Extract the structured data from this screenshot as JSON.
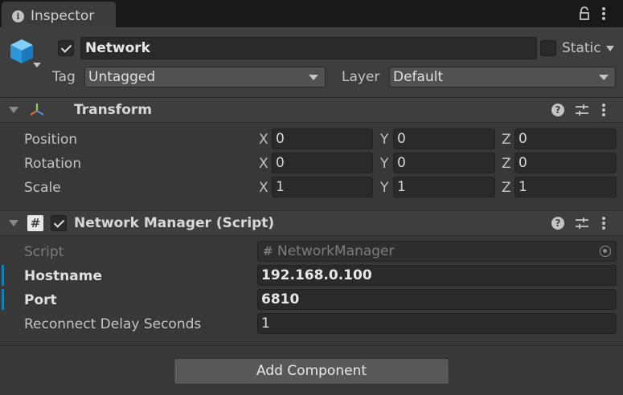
{
  "tab": {
    "title": "Inspector"
  },
  "object": {
    "name": "Network",
    "active": true,
    "static_label": "Static",
    "tag_label": "Tag",
    "tag_value": "Untagged",
    "layer_label": "Layer",
    "layer_value": "Default"
  },
  "transform": {
    "title": "Transform",
    "rows": [
      {
        "label": "Position",
        "x": "0",
        "y": "0",
        "z": "0"
      },
      {
        "label": "Rotation",
        "x": "0",
        "y": "0",
        "z": "0"
      },
      {
        "label": "Scale",
        "x": "1",
        "y": "1",
        "z": "1"
      }
    ],
    "axis": {
      "x": "X",
      "y": "Y",
      "z": "Z"
    }
  },
  "network_manager": {
    "title": "Network Manager (Script)",
    "enabled": true,
    "script_label": "Script",
    "script_value": "NetworkManager",
    "hostname_label": "Hostname",
    "hostname_value": "192.168.0.100",
    "port_label": "Port",
    "port_value": "6810",
    "reconnect_label": "Reconnect Delay Seconds",
    "reconnect_value": "1"
  },
  "add_component_label": "Add Component",
  "colors": {
    "background": "#383838",
    "header": "#3e3e3e",
    "field": "#2a2a2a",
    "override_accent": "#0f81be",
    "cube": "#3fa8e6"
  }
}
